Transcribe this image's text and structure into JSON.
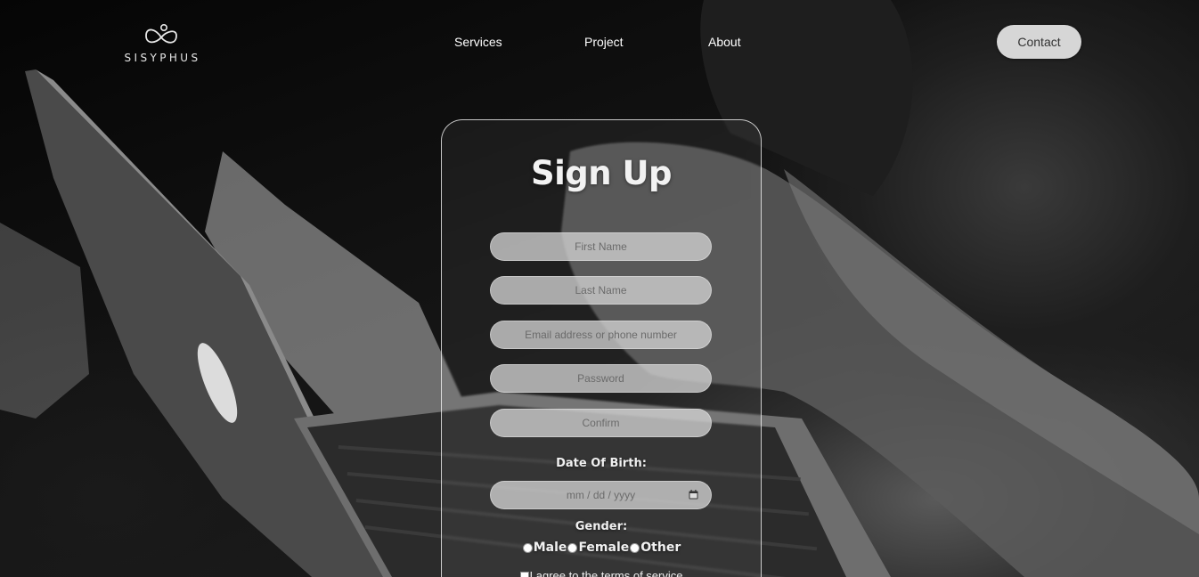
{
  "brand": {
    "name": "SISYPHUS"
  },
  "nav": {
    "items": [
      {
        "label": "Services"
      },
      {
        "label": "Project"
      },
      {
        "label": "About"
      }
    ],
    "contact_label": "Contact"
  },
  "signup": {
    "title": "Sign Up",
    "fields": {
      "first_name": {
        "placeholder": "First Name"
      },
      "last_name": {
        "placeholder": "Last Name"
      },
      "email": {
        "placeholder": "Email address or phone number"
      },
      "password": {
        "placeholder": "Password"
      },
      "confirm": {
        "placeholder": "Confirm"
      }
    },
    "dob_label": "Date Of Birth:",
    "dob_placeholder": "mm / dd / yyyy",
    "gender_label": "Gender:",
    "gender_options": [
      "Male",
      "Female",
      "Other"
    ],
    "terms_label": "I agree to the terms of service"
  },
  "colors": {
    "contact_bg": "#d6d6d6",
    "field_bg": "#d2d2d2",
    "card_border": "#ffffff"
  }
}
